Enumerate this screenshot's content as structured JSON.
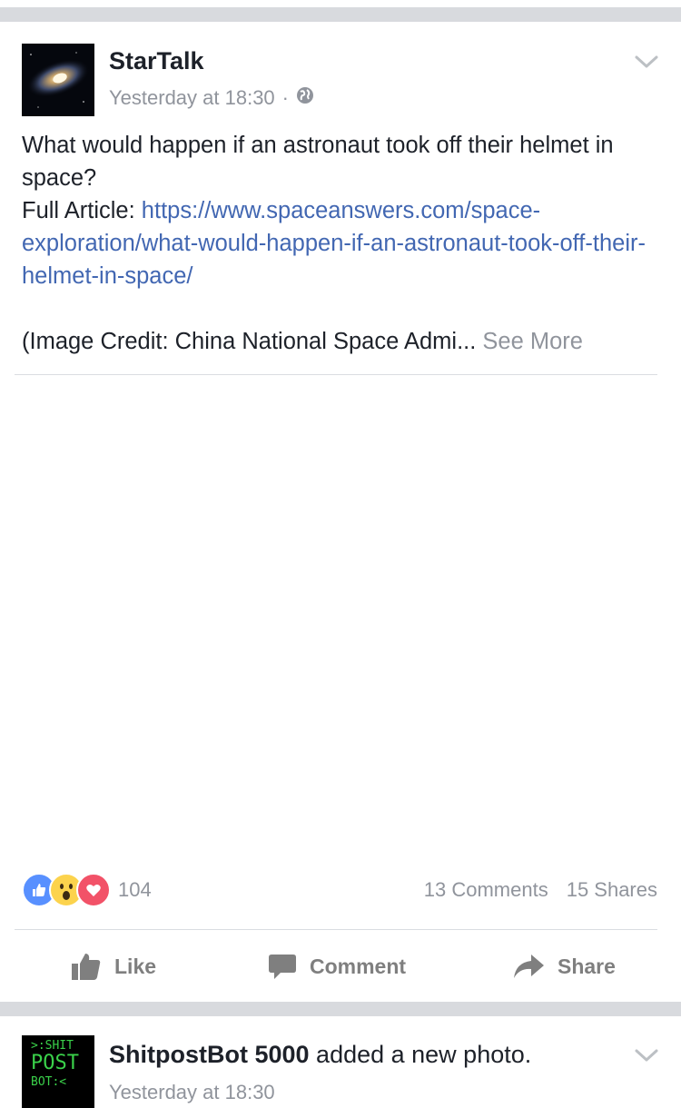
{
  "post": {
    "author": "StarTalk",
    "timestamp": "Yesterday at 18:30",
    "meta_separator": "·",
    "privacy_icon": "globe-icon",
    "text_line1": "What would happen if an astronaut took off their helmet in space?",
    "link_prefix": "Full Article: ",
    "link_url": "https://www.spaceanswers.com/space-exploration/what-would-happen-if-an-astronaut-took-off-their-helmet-in-space/",
    "credit_text": "(Image Credit: China National Space Admi...",
    "see_more": "See More",
    "reactions": {
      "icons": [
        "like-reaction-icon",
        "wow-reaction-icon",
        "love-reaction-icon"
      ],
      "count": "104"
    },
    "comments": "13 Comments",
    "shares": "15 Shares",
    "actions": {
      "like": "Like",
      "comment": "Comment",
      "share": "Share"
    }
  },
  "next_post": {
    "avatar_text": [
      ">:SHIT",
      "POST",
      "BOT:<"
    ],
    "author": "ShitpostBot 5000",
    "action_text": " added a new photo.",
    "timestamp": "Yesterday at 18:30"
  },
  "colors": {
    "link": "#4267b2",
    "muted": "#90949c",
    "like_blue": "#5890ff",
    "love_red": "#f25268",
    "wow_yellow": "#fcd34d",
    "separator": "#d8dade"
  }
}
